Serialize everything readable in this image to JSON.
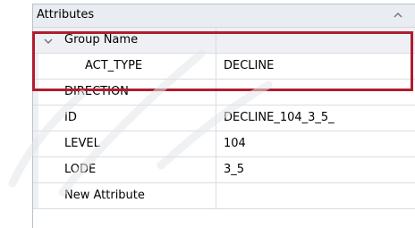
{
  "panel": {
    "title": "Attributes",
    "collapse_icon": "chevron-up-icon"
  },
  "group": {
    "name": "Group Name",
    "expand_icon": "chevron-down-icon",
    "child": {
      "name": "ACT_TYPE",
      "value": "DECLINE"
    }
  },
  "attributes": [
    {
      "name": "DIRECTION",
      "value": ""
    },
    {
      "name": "ID",
      "value": "DECLINE_104_3_5_"
    },
    {
      "name": "LEVEL",
      "value": "104"
    },
    {
      "name": "LODE",
      "value": "3_5"
    },
    {
      "name": "New Attribute",
      "value": ""
    }
  ],
  "colors": {
    "highlight_border": "#b01c2e",
    "header_background": "#e9ecf0",
    "gutter": "#eef0f3",
    "grid_line": "#d8dde3"
  }
}
